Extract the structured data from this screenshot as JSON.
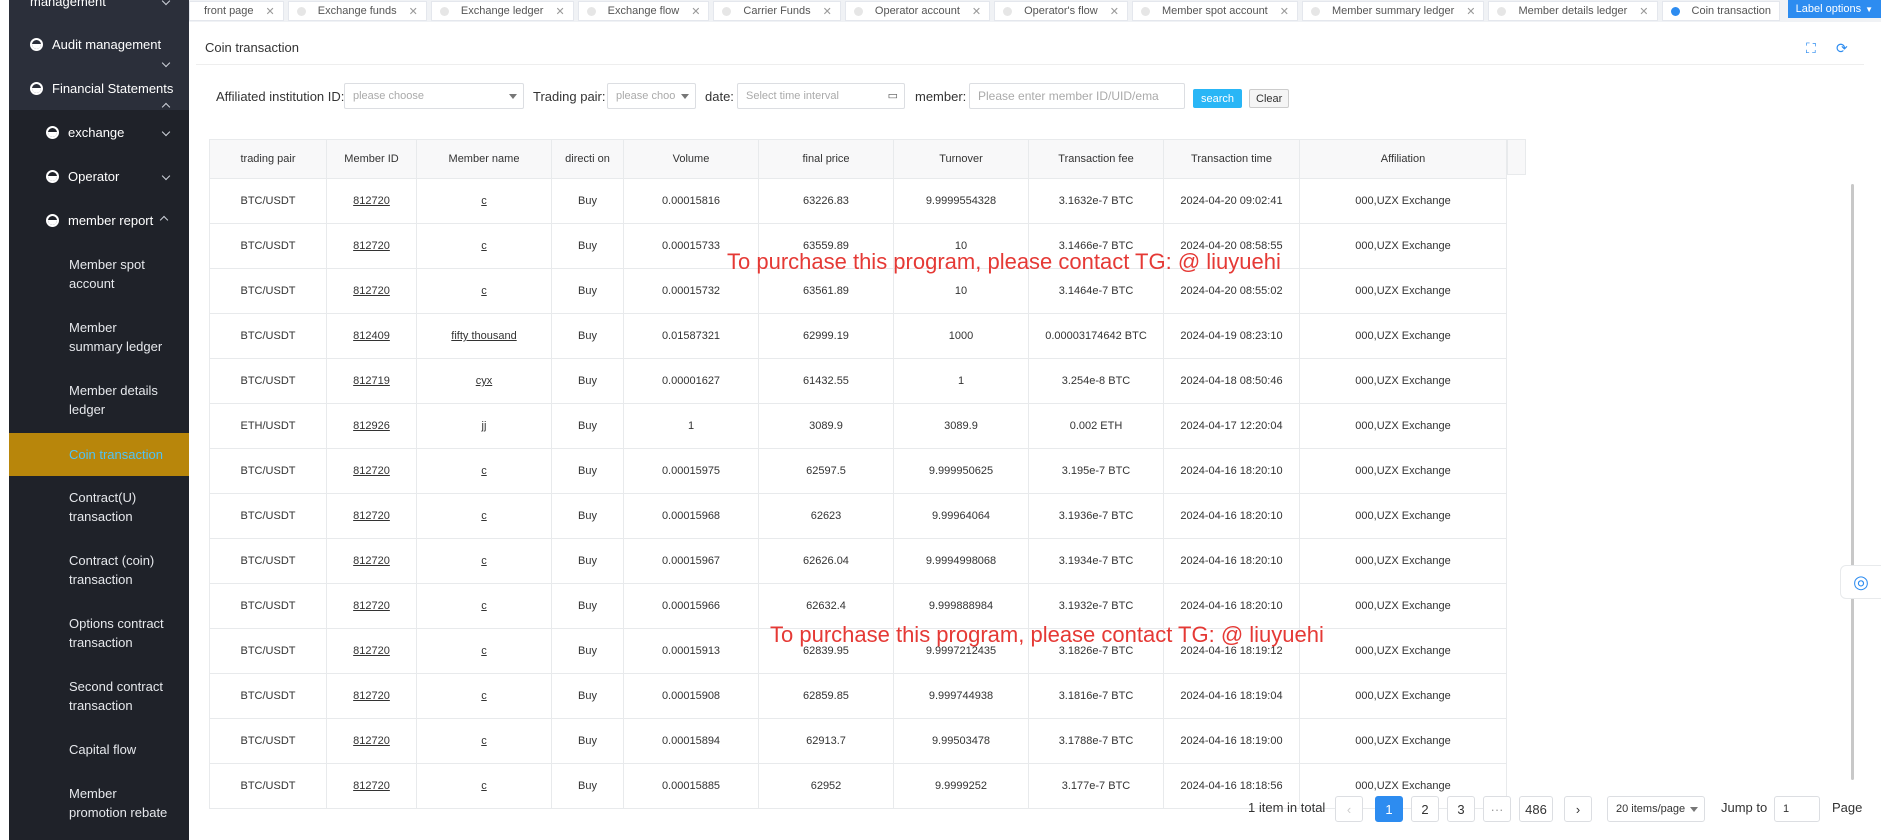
{
  "sidebar": {
    "top_partial": "management",
    "items": [
      {
        "label": "Audit management"
      },
      {
        "label": "Financial Statements"
      },
      {
        "label": "exchange"
      },
      {
        "label": "Operator"
      },
      {
        "label": "member report"
      }
    ],
    "leaves": [
      "Member spot account",
      "Member summary ledger",
      "Member details ledger",
      "Coin transaction",
      "Contract(U) transaction",
      "Contract (coin) transaction",
      "Options contract transaction",
      "Second contract transaction",
      "Capital flow",
      "Member promotion rebate"
    ]
  },
  "tabs": [
    "front page",
    "Exchange funds",
    "Exchange ledger",
    "Exchange flow",
    "Carrier Funds",
    "Operator account",
    "Operator's flow",
    "Member spot account",
    "Member summary ledger",
    "Member details ledger",
    "Coin transaction"
  ],
  "label_options": "Label options",
  "panel": {
    "title": "Coin transaction",
    "fullscreen_icon": "fullscreen-icon",
    "refresh_icon": "refresh-icon"
  },
  "filters": {
    "institution_label": "Affiliated institution ID:",
    "institution_placeholder": "please choose",
    "pair_label": "Trading pair:",
    "pair_placeholder": "please choo",
    "date_label": "date:",
    "date_placeholder": "Select time interval",
    "member_label": "member:",
    "member_placeholder": "Please enter member ID/UID/ema",
    "search": "search",
    "clear": "Clear"
  },
  "table": {
    "headers": [
      "trading pair",
      "Member ID",
      "Member name",
      "directi on",
      "Volume",
      "final price",
      "Turnover",
      "Transaction fee",
      "Transaction time",
      "Affiliation"
    ],
    "rows": [
      [
        "BTC/USDT",
        "812720",
        "c",
        "Buy",
        "0.00015816",
        "63226.83",
        "9.9999554328",
        "3.1632e-7 BTC",
        "2024-04-20 09:02:41",
        "000,UZX Exchange"
      ],
      [
        "BTC/USDT",
        "812720",
        "c",
        "Buy",
        "0.00015733",
        "63559.89",
        "10",
        "3.1466e-7 BTC",
        "2024-04-20 08:58:55",
        "000,UZX Exchange"
      ],
      [
        "BTC/USDT",
        "812720",
        "c",
        "Buy",
        "0.00015732",
        "63561.89",
        "10",
        "3.1464e-7 BTC",
        "2024-04-20 08:55:02",
        "000,UZX Exchange"
      ],
      [
        "BTC/USDT",
        "812409",
        "fifty thousand",
        "Buy",
        "0.01587321",
        "62999.19",
        "1000",
        "0.00003174642 BTC",
        "2024-04-19 08:23:10",
        "000,UZX Exchange"
      ],
      [
        "BTC/USDT",
        "812719",
        "cyx",
        "Buy",
        "0.00001627",
        "61432.55",
        "1",
        "3.254e-8 BTC",
        "2024-04-18 08:50:46",
        "000,UZX Exchange"
      ],
      [
        "ETH/USDT",
        "812926",
        "jj",
        "Buy",
        "1",
        "3089.9",
        "3089.9",
        "0.002 ETH",
        "2024-04-17 12:20:04",
        "000,UZX Exchange"
      ],
      [
        "BTC/USDT",
        "812720",
        "c",
        "Buy",
        "0.00015975",
        "62597.5",
        "9.999950625",
        "3.195e-7 BTC",
        "2024-04-16 18:20:10",
        "000,UZX Exchange"
      ],
      [
        "BTC/USDT",
        "812720",
        "c",
        "Buy",
        "0.00015968",
        "62623",
        "9.99964064",
        "3.1936e-7 BTC",
        "2024-04-16 18:20:10",
        "000,UZX Exchange"
      ],
      [
        "BTC/USDT",
        "812720",
        "c",
        "Buy",
        "0.00015967",
        "62626.04",
        "9.9994998068",
        "3.1934e-7 BTC",
        "2024-04-16 18:20:10",
        "000,UZX Exchange"
      ],
      [
        "BTC/USDT",
        "812720",
        "c",
        "Buy",
        "0.00015966",
        "62632.4",
        "9.999888984",
        "3.1932e-7 BTC",
        "2024-04-16 18:20:10",
        "000,UZX Exchange"
      ],
      [
        "BTC/USDT",
        "812720",
        "c",
        "Buy",
        "0.00015913",
        "62839.95",
        "9.9997212435",
        "3.1826e-7 BTC",
        "2024-04-16 18:19:12",
        "000,UZX Exchange"
      ],
      [
        "BTC/USDT",
        "812720",
        "c",
        "Buy",
        "0.00015908",
        "62859.85",
        "9.999744938",
        "3.1816e-7 BTC",
        "2024-04-16 18:19:04",
        "000,UZX Exchange"
      ],
      [
        "BTC/USDT",
        "812720",
        "c",
        "Buy",
        "0.00015894",
        "62913.7",
        "9.99503478",
        "3.1788e-7 BTC",
        "2024-04-16 18:19:00",
        "000,UZX Exchange"
      ],
      [
        "BTC/USDT",
        "812720",
        "c",
        "Buy",
        "0.00015885",
        "62952",
        "9.9999252",
        "3.177e-7 BTC",
        "2024-04-16 18:18:56",
        "000,UZX Exchange"
      ]
    ]
  },
  "watermark": "To purchase this program, please contact TG: @ liuyuehi",
  "pagination": {
    "total": "1 item in total",
    "pages": [
      "1",
      "2",
      "3",
      "···",
      "486"
    ],
    "page_size": "20 items/page",
    "jump_label": "Jump to",
    "jump_value": "1",
    "page_label": "Page"
  },
  "colors": {
    "sidebar_bg": "#2b2f3a",
    "active_item_bg": "#b8860b",
    "primary": "#2d8cf0",
    "search_btn": "#29b6f6",
    "watermark": "#e53935"
  }
}
